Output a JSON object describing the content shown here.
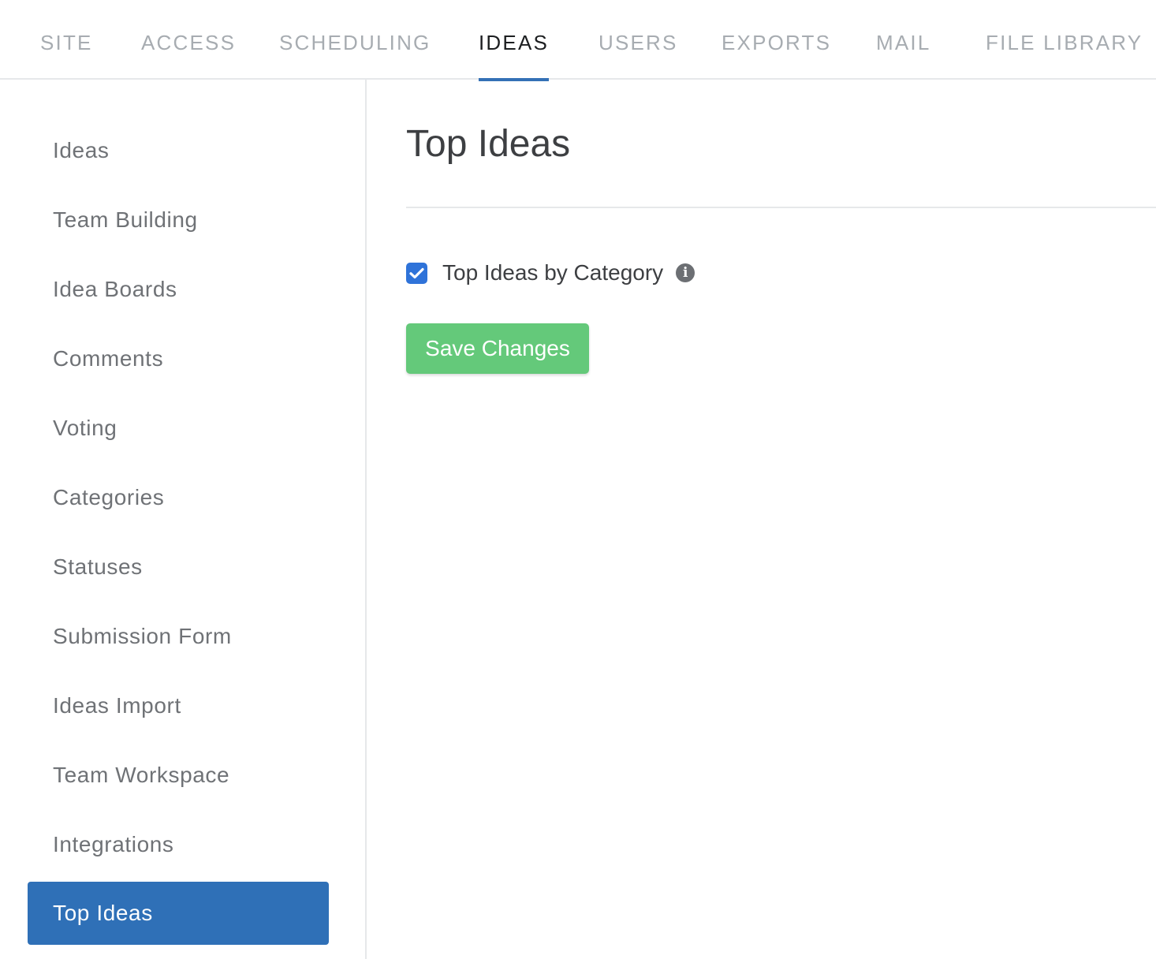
{
  "top_tabs": [
    {
      "label": "SITE"
    },
    {
      "label": "ACCESS"
    },
    {
      "label": "SCHEDULING"
    },
    {
      "label": "IDEAS",
      "active": true
    },
    {
      "label": "USERS"
    },
    {
      "label": "EXPORTS"
    },
    {
      "label": "MAIL"
    },
    {
      "label": "FILE LIBRARY"
    }
  ],
  "sidebar": {
    "items": [
      {
        "label": "Ideas"
      },
      {
        "label": "Team Building"
      },
      {
        "label": "Idea Boards"
      },
      {
        "label": "Comments"
      },
      {
        "label": "Voting"
      },
      {
        "label": "Categories"
      },
      {
        "label": "Statuses"
      },
      {
        "label": "Submission Form"
      },
      {
        "label": "Ideas Import"
      },
      {
        "label": "Team Workspace"
      },
      {
        "label": "Integrations"
      },
      {
        "label": "Top Ideas",
        "active": true
      }
    ]
  },
  "main": {
    "title": "Top Ideas",
    "option": {
      "label": "Top Ideas by Category",
      "checked": true,
      "info_icon": "info-circle-icon"
    },
    "save_label": "Save Changes"
  },
  "colors": {
    "accent": "#2f70b7",
    "checkbox": "#2f73d9",
    "save_button": "#64c97a",
    "tab_inactive": "#a7acb1",
    "tab_active": "#1d1f21"
  }
}
